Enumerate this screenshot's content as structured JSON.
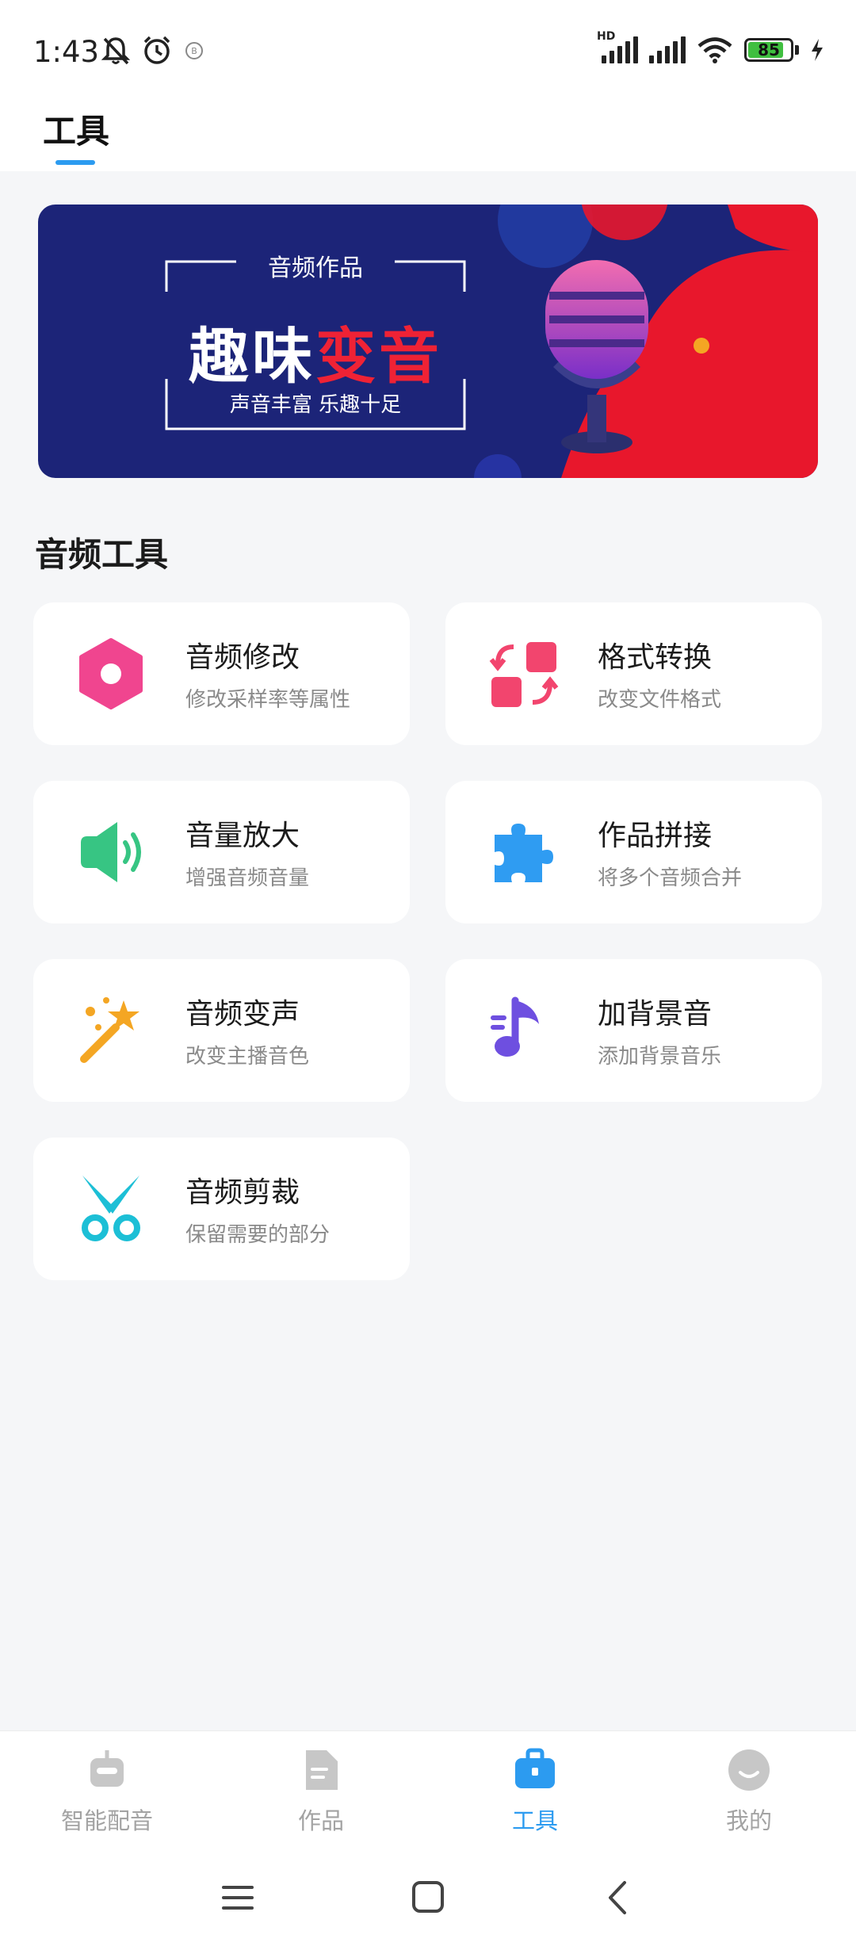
{
  "status_bar": {
    "time": "1:43",
    "battery": "85",
    "icons": [
      "mute-bell-icon",
      "alarm-icon",
      "app-notification-icon",
      "hd-signal-icon",
      "signal-icon",
      "wifi-icon",
      "battery-icon",
      "charging-icon"
    ]
  },
  "header": {
    "title": "工具"
  },
  "banner": {
    "small_title": "音频作品",
    "big_title_white": "趣味",
    "big_title_red": "变音",
    "subtitle": "声音丰富 乐趣十足"
  },
  "section": {
    "title": "音频工具"
  },
  "tools": [
    {
      "title": "音频修改",
      "sub": "修改采样率等属性",
      "icon": "hexagon-icon",
      "color": "#f0458f"
    },
    {
      "title": "格式转换",
      "sub": "改变文件格式",
      "icon": "convert-icon",
      "color": "#f2456e"
    },
    {
      "title": "音量放大",
      "sub": "增强音频音量",
      "icon": "speaker-icon",
      "color": "#37c583"
    },
    {
      "title": "作品拼接",
      "sub": "将多个音频合并",
      "icon": "puzzle-icon",
      "color": "#2f9cf2"
    },
    {
      "title": "音频变声",
      "sub": "改变主播音色",
      "icon": "magic-wand-icon",
      "color": "#f4a623"
    },
    {
      "title": "加背景音",
      "sub": "添加背景音乐",
      "icon": "music-note-icon",
      "color": "#6e4fe0"
    },
    {
      "title": "音频剪裁",
      "sub": "保留需要的部分",
      "icon": "scissors-icon",
      "color": "#1cbfd6"
    }
  ],
  "bottom_nav": [
    {
      "label": "智能配音",
      "icon": "robot-icon",
      "active": false
    },
    {
      "label": "作品",
      "icon": "document-icon",
      "active": false
    },
    {
      "label": "工具",
      "icon": "toolbox-icon",
      "active": true
    },
    {
      "label": "我的",
      "icon": "smile-icon",
      "active": false
    }
  ],
  "colors": {
    "accent": "#2c9bf0",
    "banner_bg": "#1c2478",
    "banner_red": "#e8172c"
  }
}
